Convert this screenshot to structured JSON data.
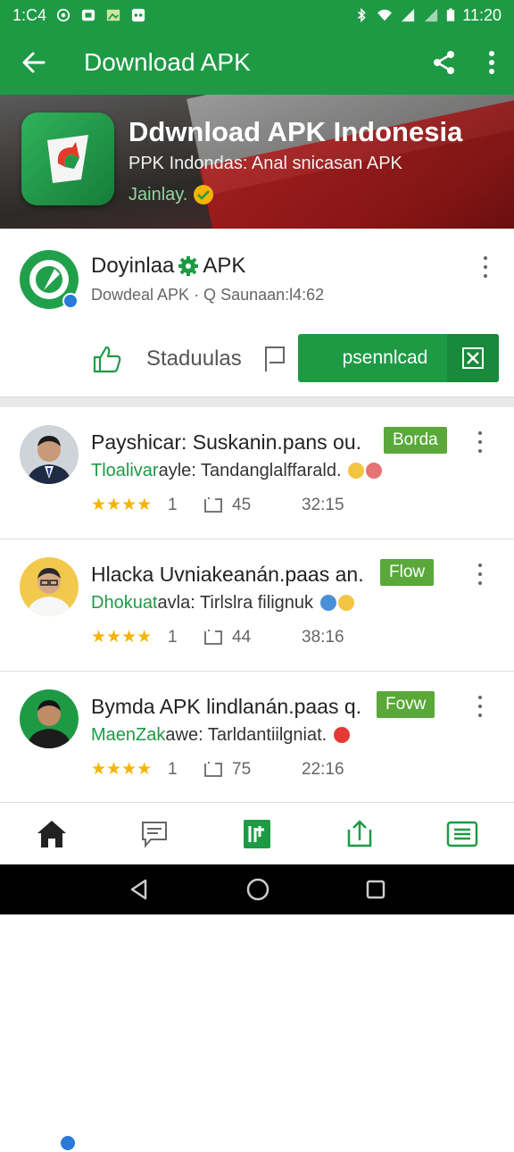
{
  "status_bar": {
    "time_left": "1:C4",
    "time_right": "11:20"
  },
  "app_bar": {
    "title": "Download APK"
  },
  "hero": {
    "title": "Ddwnload APK Indonesia",
    "subtitle": "PPK Indondas: Anal snicasan APK",
    "tag": "Jainlay."
  },
  "publisher": {
    "name_part1": "Doyinlaa",
    "name_part2": "APK",
    "meta": "Dowdeal APK · Q Saunaan:l4:62",
    "stat_label": "Staduulas",
    "download_label": "psennlcad"
  },
  "feed": [
    {
      "title": "Payshicar: Suskanin.pans ou.",
      "tag": "Borda",
      "sub_lead": "Tloalivar",
      "sub_rest": "ayle: Tandanglalffarald.",
      "rating": "1",
      "comments": "45",
      "time": "32:15",
      "tag_color": "#5aa83a"
    },
    {
      "title": "Hlacka Uvniakeanán.paas an.",
      "tag": "Flow",
      "sub_lead": "Dhokuat",
      "sub_rest": "avla: Tirlslra filignuk",
      "rating": "1",
      "comments": "44",
      "time": "38:16",
      "tag_color": "#5aa83a"
    },
    {
      "title": "Bymda APK lindlanán.paas q.",
      "tag": "Fovw",
      "sub_lead": "MaenZak",
      "sub_rest": "awe: Tarldantiilgniat.",
      "rating": "1",
      "comments": "75",
      "time": "22:16",
      "tag_color": "#5aa83a"
    }
  ],
  "stars_text": "★★★★",
  "colors": {
    "primary": "#1e9a45",
    "accent_tag": "#5aa83a",
    "star": "#f4b400"
  },
  "icons": [
    "back-arrow-icon",
    "share-icon",
    "more-vert-icon",
    "home-icon",
    "chat-icon",
    "apps-icon",
    "upload-icon",
    "list-icon"
  ]
}
